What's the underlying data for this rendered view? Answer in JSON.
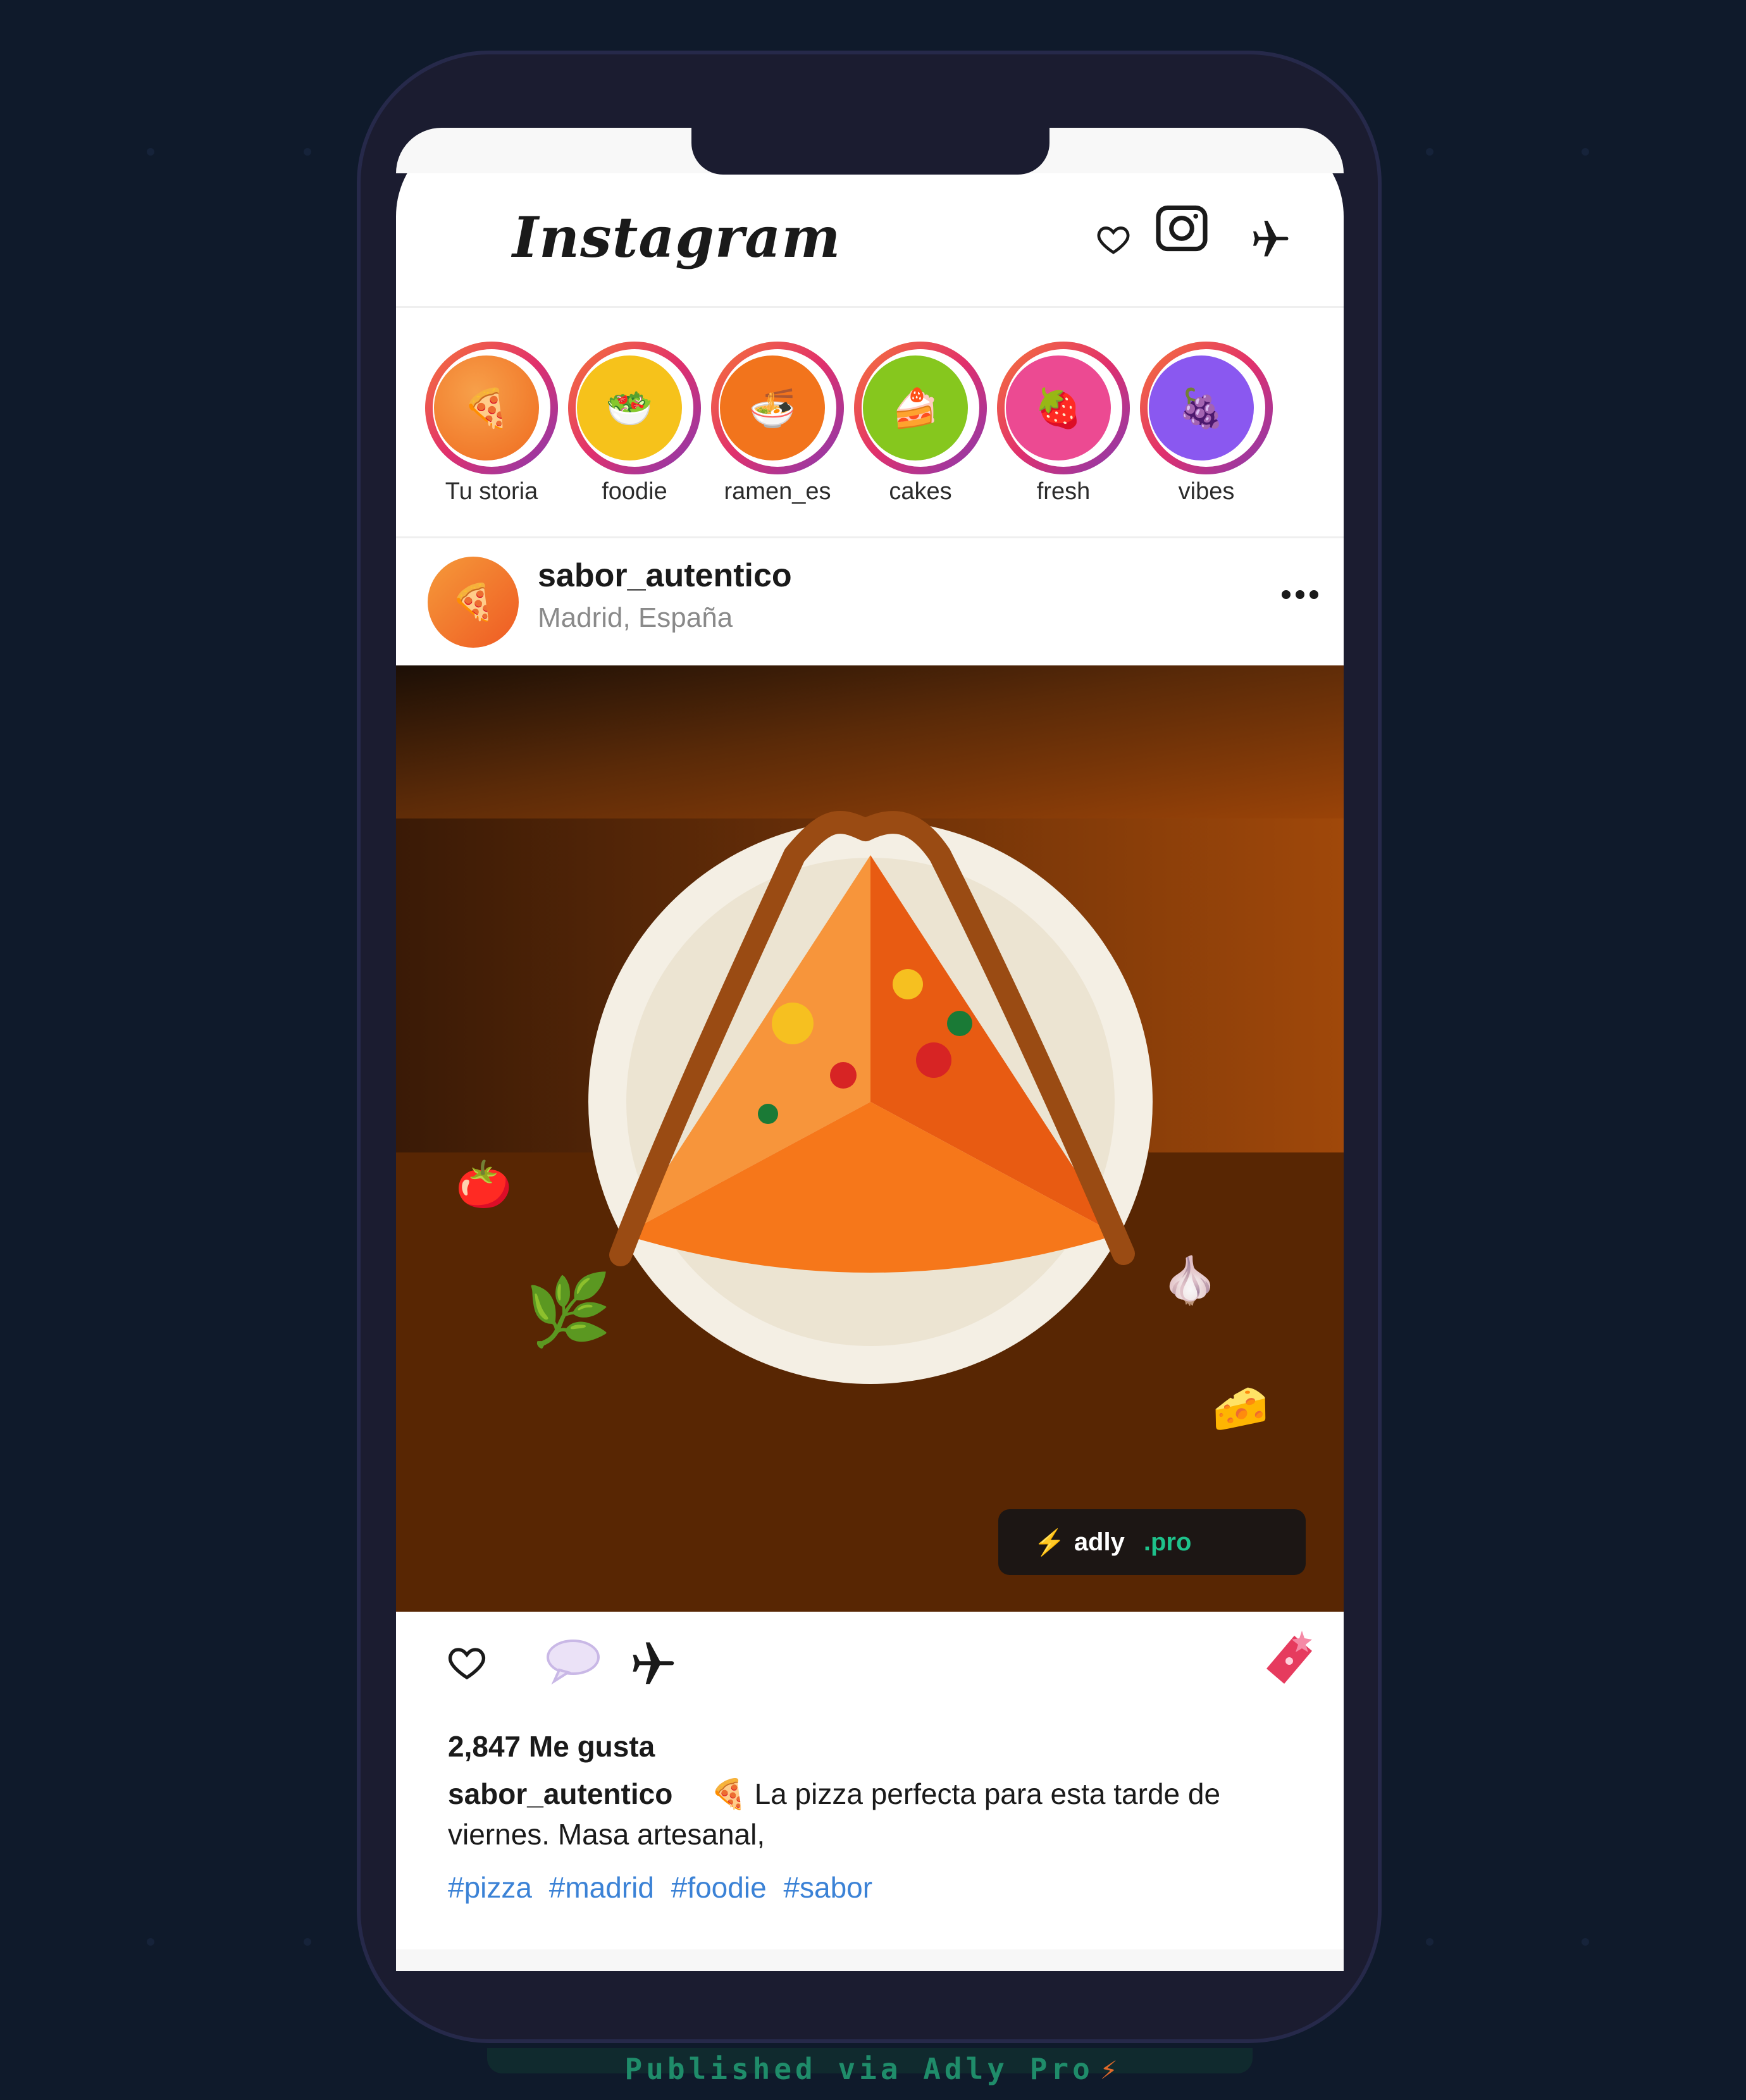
{
  "header": {
    "title": "Instagram",
    "icons": [
      "heart-icon",
      "camera-icon",
      "direct-message-icon"
    ]
  },
  "stories": [
    {
      "label": "Tu storia",
      "emoji": "🍕",
      "color": "#ef7d2a"
    },
    {
      "label": "foodie",
      "emoji": "🥗",
      "color": "#f6c21b"
    },
    {
      "label": "ramen_es",
      "emoji": "🍜",
      "color": "#f2741c"
    },
    {
      "label": "cakes",
      "emoji": "🍰",
      "color": "#86c71e"
    },
    {
      "label": "fresh",
      "emoji": "🍓",
      "color": "#ec4a92"
    },
    {
      "label": "vibes",
      "emoji": "🍇",
      "color": "#8a58f0"
    }
  ],
  "post": {
    "avatar_emoji": "🍕",
    "username": "sabor_autentico",
    "location": "Madrid, España",
    "image_decorations": [
      "🍅",
      "🌿",
      "🧄",
      "🧀"
    ],
    "watermark": {
      "bolt": "⚡",
      "brand": "adly",
      "suffix": ".pro"
    },
    "likes": "2,847 Me gusta",
    "caption": {
      "username": "sabor_autentico",
      "emoji": "🍕",
      "text": "La pizza perfecta para esta tarde de viernes. Masa artesanal,"
    },
    "hashtags": [
      "#pizza",
      "#madrid",
      "#foodie",
      "#sabor"
    ]
  },
  "footer": {
    "text": "Published via Adly Pro",
    "bolt": "⚡"
  },
  "colors": {
    "background": "#0f1a2b",
    "phone": "#1b1c30",
    "hashtag": "#3b82d6",
    "story_ring_start": "#f77737",
    "story_ring_end": "#833ab4",
    "brand_green": "#1ec28b"
  }
}
